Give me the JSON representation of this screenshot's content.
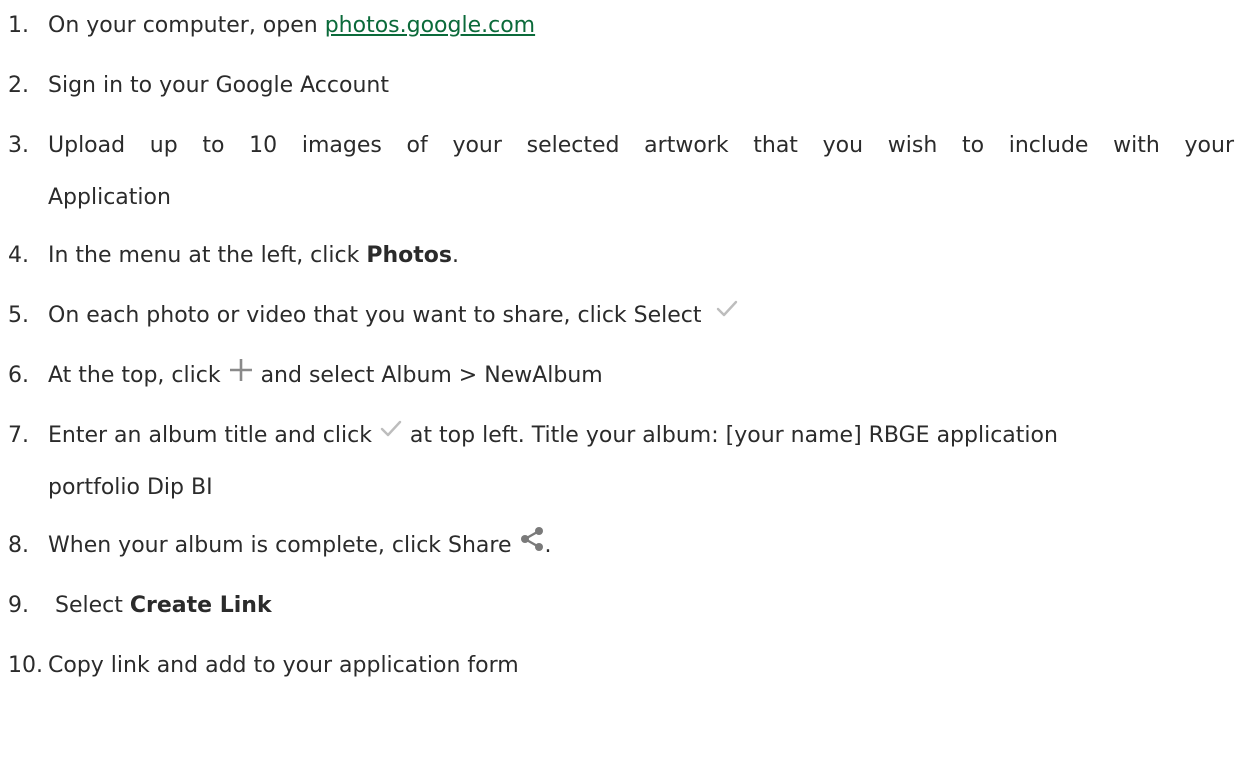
{
  "steps": [
    {
      "num": "1.",
      "pre": "On your computer, open ",
      "link": "photos.google.com"
    },
    {
      "num": "2.",
      "text": "Sign in to your Google Account"
    },
    {
      "num": "3.",
      "line1": [
        "Upload",
        "up",
        "to",
        "10",
        "images",
        "of",
        "your",
        "selected",
        "artwork",
        "that",
        "you",
        "wish",
        "to",
        "include",
        "with",
        "your"
      ],
      "line2": "Application"
    },
    {
      "num": "4.",
      "pre": "In the menu at the left, click ",
      "bold": "Photos",
      "post": "."
    },
    {
      "num": "5.",
      "text": "On each photo or video that you want to share, click Select ",
      "icon": "check-icon"
    },
    {
      "num": "6.",
      "pre": "At the top, click ",
      "icon": "plus-icon",
      "post": " and select Album > NewAlbum"
    },
    {
      "num": "7.",
      "pre": "Enter an album title and click ",
      "icon": "check-icon",
      "post": " at top left. Title your album: [your name] RBGE application",
      "line2": "portfolio Dip BI"
    },
    {
      "num": "8.",
      "pre": "When your album is complete, click Share ",
      "icon": "share-icon",
      "post": "."
    },
    {
      "num": "9.",
      "pre": " Select ",
      "bold": "Create Link"
    },
    {
      "num": "10.",
      "text": "Copy link and add to your application form"
    }
  ]
}
